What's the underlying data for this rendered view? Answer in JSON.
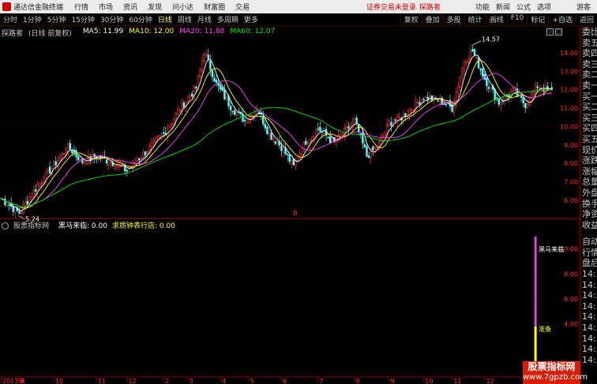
{
  "app": {
    "title": "通达信金融终端",
    "menus": [
      "行情",
      "市场",
      "资讯",
      "发现",
      "问小达",
      "财富圈",
      "交易"
    ],
    "alert": "证券交易未登录",
    "alert_user": "探路者",
    "right_menus": [
      "功能",
      "新闻",
      "公式",
      "选项"
    ],
    "guest": "游客"
  },
  "toolbar": {
    "periods": [
      "分时",
      "1分钟",
      "5分钟",
      "15分钟",
      "30分钟",
      "60分钟",
      "日线",
      "周线",
      "月线",
      "多周期",
      "更多"
    ],
    "active_period": "日线",
    "right_buttons": [
      "复权",
      "叠加",
      "多股",
      "统计",
      "画线",
      "F10",
      "标记",
      "+自选",
      "返回"
    ]
  },
  "colors": {
    "up": "#ff3232",
    "down": "#54fcfc",
    "ma5": "#ffffff",
    "ma10": "#ffff00",
    "ma20": "#ff40ff",
    "ma60": "#00e600",
    "grid": "#5a0000",
    "axis": "#ff3232"
  },
  "price_panel": {
    "stock_name": "探路者",
    "mode": "(日线 前复权)",
    "ma5_label": "MA5: 11.99",
    "ma10_label": "MA10: 12.00",
    "ma20_label": "MA20: 11.88",
    "ma60_label": "MA60: 12.07",
    "high_label": "14.57",
    "low_label": "5.24",
    "marker": "B"
  },
  "indicator_panel": {
    "name": "股票指标网",
    "line1_label": "黑马来临: 0.00",
    "line2_label": "求质钟表行店: 0.00",
    "signal_label": "黑马来临",
    "prepare_label": "准备"
  },
  "sidebar": {
    "items": [
      "委比",
      "卖五",
      "卖四",
      "卖三",
      "卖二",
      "卖一",
      "买一",
      "买二",
      "买三",
      "买四",
      "买五",
      "现价",
      "涨跌",
      "涨幅",
      "总量",
      "外盘",
      "换手",
      "净资",
      "收益"
    ],
    "indicator_items": [
      "自动",
      "行情",
      "盘后",
      "14:50",
      "14:50",
      "14:50",
      "14:50",
      "14:50",
      "14:50",
      "14:50",
      "14:50",
      "14:50"
    ]
  },
  "watermark": {
    "title": "股票指标网",
    "url": "www.7gpzb.com"
  },
  "chart_data": {
    "type": "candlestick",
    "y_ticks": [
      6.0,
      7.0,
      8.0,
      9.0,
      10.0,
      11.0,
      12.0,
      13.0,
      14.0
    ],
    "ylim": [
      5.05,
      14.9
    ],
    "indicator_y_ticks": [
      4.0,
      6.0,
      8.0,
      10.0
    ],
    "indicator_ylim": [
      0,
      11.5
    ],
    "x_tick_labels": [
      "2013年",
      "9",
      "10",
      "11",
      "12",
      "2",
      "3",
      "4",
      "5",
      "6",
      "7",
      "8",
      "9",
      "10",
      "11",
      "12"
    ],
    "x_tick_positions": [
      0,
      9,
      26,
      47,
      62,
      80,
      92,
      108,
      122,
      138,
      156,
      174,
      191,
      208,
      222,
      238
    ],
    "bars": 272,
    "anchors": [
      [
        0,
        6.1
      ],
      [
        9,
        5.3
      ],
      [
        18,
        6.8
      ],
      [
        26,
        7.9
      ],
      [
        33,
        8.9
      ],
      [
        40,
        8.1
      ],
      [
        47,
        8.4
      ],
      [
        56,
        8.0
      ],
      [
        62,
        7.6
      ],
      [
        70,
        8.5
      ],
      [
        80,
        9.6
      ],
      [
        88,
        11.0
      ],
      [
        96,
        12.1
      ],
      [
        100,
        14.1
      ],
      [
        106,
        12.3
      ],
      [
        113,
        11.1
      ],
      [
        120,
        10.3
      ],
      [
        126,
        11.0
      ],
      [
        132,
        9.6
      ],
      [
        138,
        8.9
      ],
      [
        144,
        7.8
      ],
      [
        150,
        9.2
      ],
      [
        156,
        9.9
      ],
      [
        164,
        9.1
      ],
      [
        174,
        10.3
      ],
      [
        180,
        8.4
      ],
      [
        186,
        9.0
      ],
      [
        191,
        10.2
      ],
      [
        197,
        10.5
      ],
      [
        203,
        11.1
      ],
      [
        208,
        11.6
      ],
      [
        216,
        11.4
      ],
      [
        222,
        11.0
      ],
      [
        228,
        13.6
      ],
      [
        232,
        14.1
      ],
      [
        238,
        12.6
      ],
      [
        245,
        11.3
      ],
      [
        252,
        11.9
      ],
      [
        258,
        11.2
      ],
      [
        264,
        12.2
      ],
      [
        271,
        11.9
      ]
    ],
    "signal": {
      "bar_index": 263,
      "level": 11.0
    }
  }
}
